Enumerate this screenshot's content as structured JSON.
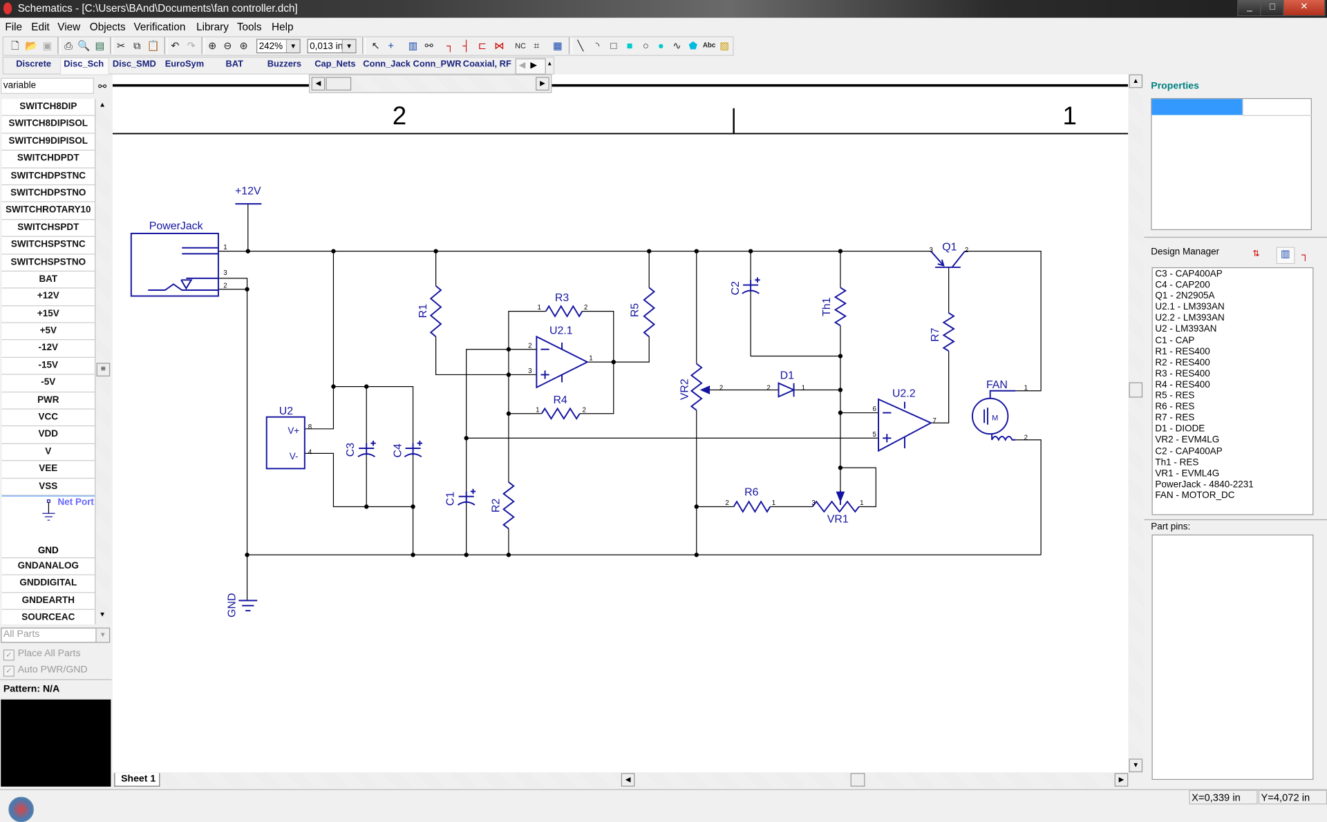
{
  "window": {
    "title": "Schematics - [C:\\Users\\BAnd\\Documents\\fan controller.dch]",
    "min": "_",
    "max": "□",
    "close": "✕"
  },
  "menu": [
    "File",
    "Edit",
    "View",
    "Objects",
    "Verification",
    "Library",
    "Tools",
    "Help"
  ],
  "toolbar": {
    "zoom_value": "242%",
    "grid_value": "0,013 in",
    "text_tool": "Abc"
  },
  "library_tabs": [
    "Discrete",
    "Disc_Sch",
    "Disc_SMD",
    "EuroSym",
    "BAT",
    "Buzzers",
    "Cap_Nets",
    "Conn_Jack",
    "Conn_PWR",
    "Coaxial, RF"
  ],
  "library_selected": "Disc_Sch",
  "left": {
    "search_value": "variable",
    "parts": [
      "SWITCH8DIP",
      "SWITCH8DIPISOL",
      "SWITCH9DIPISOL",
      "SWITCHDPDT",
      "SWITCHDPSTNC",
      "SWITCHDPSTNO",
      "SWITCHROTARY10",
      "SWITCHSPDT",
      "SWITCHSPSTNC",
      "SWITCHSPSTNO",
      "BAT",
      "+12V",
      "+15V",
      "+5V",
      "-12V",
      "-15V",
      "-5V",
      "PWR",
      "VCC",
      "VDD",
      "V",
      "VEE",
      "VSS"
    ],
    "netport_label": "Net Port",
    "netport_name": "GND",
    "parts_after": [
      "GNDANALOG",
      "GNDDIGITAL",
      "GNDEARTH",
      "SOURCEAC"
    ],
    "filter_value": "All Parts",
    "place_all_parts": "Place All Parts",
    "auto_pwr_gnd": "Auto PWR/GND",
    "place_all_checked": true,
    "auto_pwr_checked": true,
    "pattern": "Pattern: N/A"
  },
  "canvas": {
    "zone_left": "2",
    "zone_right": "1",
    "sheet_tab": "Sheet 1",
    "wire_color": "#000000",
    "component_color": "#1414a0"
  },
  "schematic": {
    "labels": {
      "plus12v": "+12V",
      "powerjack": "PowerJack",
      "gnd": "GND",
      "u2": "U2",
      "vplus": "V+",
      "vminus": "V-",
      "c3": "C3",
      "c4": "C4",
      "c1": "C1",
      "r1": "R1",
      "r2": "R2",
      "r3": "R3",
      "r4": "R4",
      "r5": "R5",
      "u21": "U2.1",
      "u22": "U2.2",
      "vr2": "VR2",
      "vr1": "VR1",
      "d1": "D1",
      "c2": "C2",
      "th1": "Th1",
      "r6": "R6",
      "r7": "R7",
      "q1": "Q1",
      "fan": "FAN"
    },
    "pins": {
      "p1": "1",
      "p2": "2",
      "p3": "3",
      "p4": "4",
      "p5": "5",
      "p6": "6",
      "p7": "7",
      "p8": "8"
    }
  },
  "right": {
    "properties_title": "Properties",
    "design_manager_title": "Design Manager",
    "components": [
      "C3 - CAP400AP",
      "C4 - CAP200",
      "Q1 - 2N2905A",
      "U2.1 - LM393AN",
      "U2.2 - LM393AN",
      "U2 - LM393AN",
      "C1 - CAP",
      "R1 - RES400",
      "R2 - RES400",
      "R3 - RES400",
      "R4 - RES400",
      "R5 - RES",
      "R6 - RES",
      "R7 - RES",
      "D1 - DIODE",
      "VR2 - EVM4LG",
      "C2 - CAP400AP",
      "Th1 - RES",
      "VR1 - EVML4G",
      "PowerJack - 4840-2231",
      "FAN - MOTOR_DC"
    ],
    "part_pins_title": "Part pins:",
    "accent": "#3399ff"
  },
  "status": {
    "x": "X=0,339 in",
    "y": "Y=4,072 in"
  }
}
